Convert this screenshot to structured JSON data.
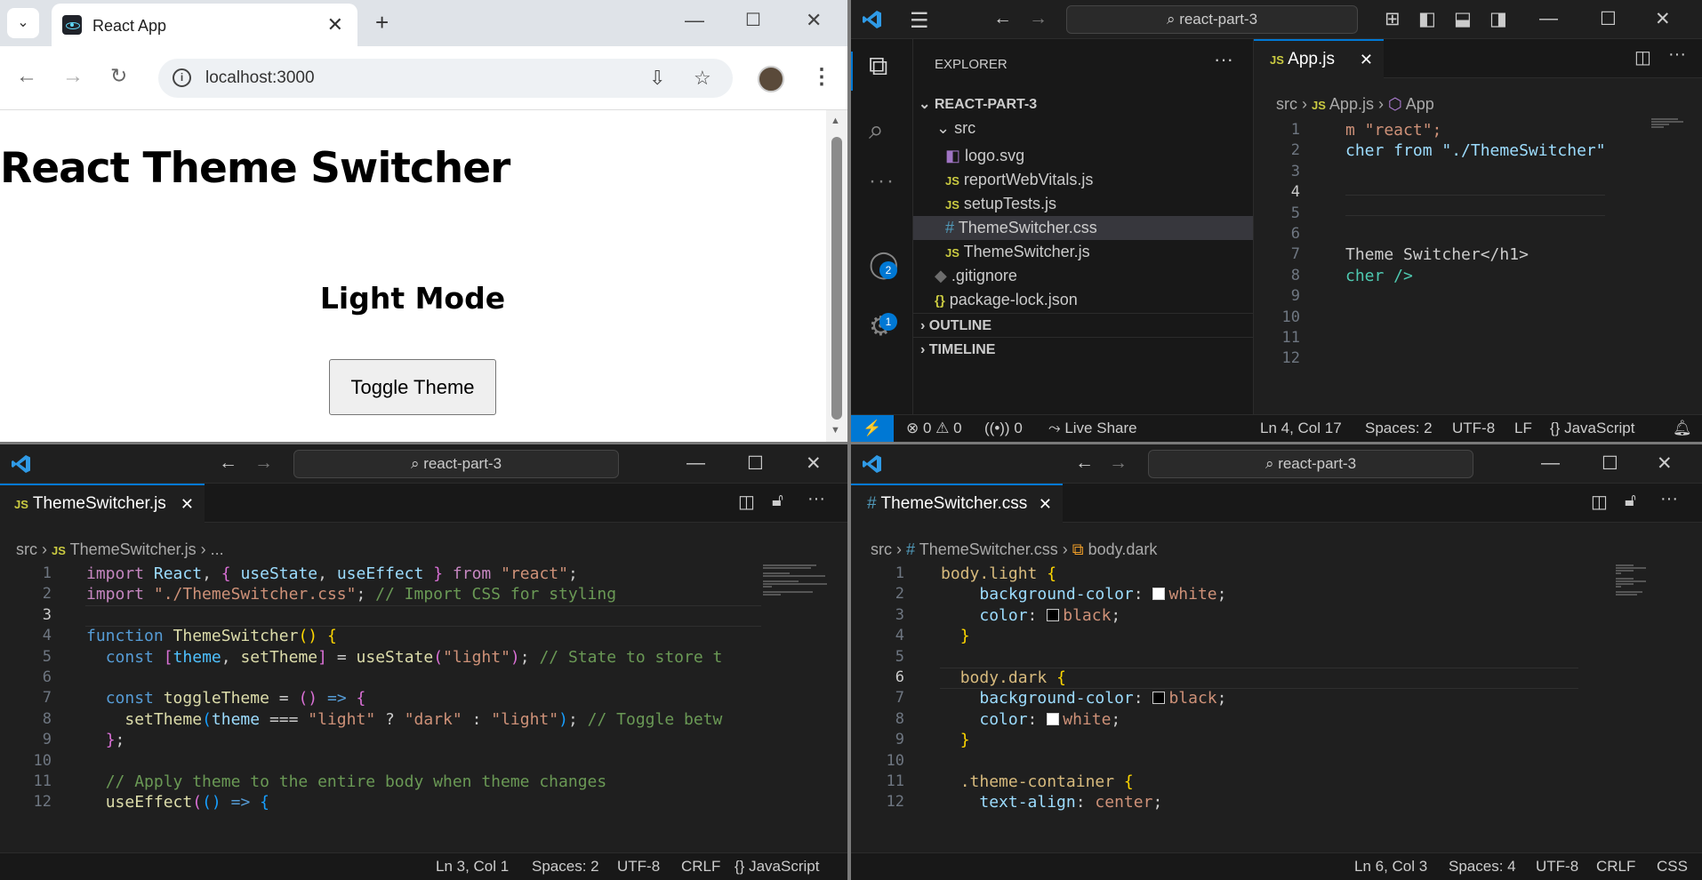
{
  "browser": {
    "tab_title": "React App",
    "address": "localhost:3000",
    "page": {
      "heading": "React Theme Switcher",
      "mode_label": "Light Mode",
      "button_label": "Toggle Theme"
    }
  },
  "vscode_top": {
    "search": "react-part-3",
    "explorer_title": "EXPLORER",
    "project": "REACT-PART-3",
    "folder": "src",
    "files": [
      {
        "name": "logo.svg",
        "kind": "svg"
      },
      {
        "name": "reportWebVitals.js",
        "kind": "js"
      },
      {
        "name": "setupTests.js",
        "kind": "js"
      },
      {
        "name": "ThemeSwitcher.css",
        "kind": "css"
      },
      {
        "name": "ThemeSwitcher.js",
        "kind": "js"
      },
      {
        "name": ".gitignore",
        "kind": "git"
      },
      {
        "name": "package-lock.json",
        "kind": "json"
      }
    ],
    "outline": "OUTLINE",
    "timeline": "TIMELINE",
    "accounts_badge": "2",
    "settings_badge": "1",
    "tab": "App.js",
    "crumbs": [
      "src",
      "App.js",
      "App"
    ],
    "line_numbers": [
      "1",
      "2",
      "3",
      "4",
      "5",
      "6",
      "7",
      "8",
      "9",
      "10",
      "11",
      "12"
    ],
    "code": [
      "m \"react\";",
      "cher from \"./ThemeSwitcher\";",
      "",
      "",
      "",
      "",
      "Theme Switcher</h1>",
      "cher />"
    ],
    "status": {
      "errors": "0",
      "warnings": "0",
      "ports": "0",
      "live_share": "Live Share",
      "position": "Ln 4, Col 17",
      "spaces": "Spaces: 2",
      "encoding": "UTF-8",
      "eol": "LF",
      "language": "JavaScript"
    }
  },
  "vscode_left": {
    "search": "react-part-3",
    "tab": "ThemeSwitcher.js",
    "crumbs": [
      "src",
      "ThemeSwitcher.js",
      "..."
    ],
    "line_numbers": [
      "1",
      "2",
      "3",
      "4",
      "5",
      "6",
      "7",
      "8",
      "9",
      "10",
      "11",
      "12"
    ],
    "code": [
      "import React, { useState, useEffect } from \"react\";",
      "import \"./ThemeSwitcher.css\"; // Import CSS for styling",
      "",
      "function ThemeSwitcher() {",
      "  const [theme, setTheme] = useState(\"light\"); // State to store t",
      "",
      "  const toggleTheme = () => {",
      "    setTheme(theme === \"light\" ? \"dark\" : \"light\"); // Toggle betw",
      "  };",
      "",
      "  // Apply theme to the entire body when theme changes",
      "  useEffect(() => {"
    ],
    "status": {
      "position": "Ln 3, Col 1",
      "spaces": "Spaces: 2",
      "encoding": "UTF-8",
      "eol": "CRLF",
      "language": "JavaScript"
    }
  },
  "vscode_right": {
    "search": "react-part-3",
    "tab": "ThemeSwitcher.css",
    "crumbs": [
      "src",
      "ThemeSwitcher.css",
      "body.dark"
    ],
    "line_numbers": [
      "1",
      "2",
      "3",
      "4",
      "5",
      "6",
      "7",
      "8",
      "9",
      "10",
      "11",
      "12"
    ],
    "code": [
      "body.light {",
      "    background-color: white;",
      "    color: black;",
      "  }",
      "",
      "  body.dark {",
      "    background-color: black;",
      "    color: white;",
      "  }",
      "",
      "  .theme-container {",
      "    text-align: center;"
    ],
    "status": {
      "position": "Ln 6, Col 3",
      "spaces": "Spaces: 4",
      "encoding": "UTF-8",
      "eol": "CRLF",
      "language": "CSS"
    }
  },
  "colors": {
    "vscode_bg": "#1f1f1f",
    "accent": "#0078d4",
    "js_icon": "#cbcb41",
    "css_icon": "#519aba"
  }
}
